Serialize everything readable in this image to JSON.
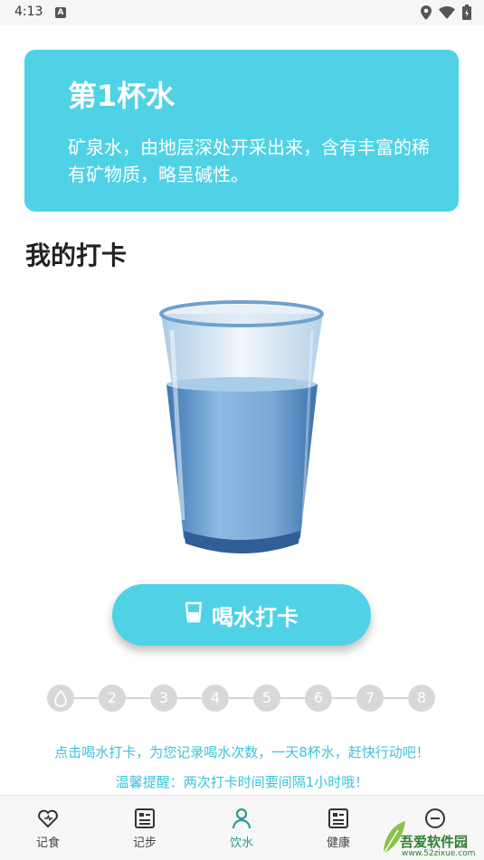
{
  "status_bar": {
    "time": "4:13",
    "notification_icon": "A",
    "icons": [
      "location-icon",
      "wifi-icon",
      "battery-icon"
    ]
  },
  "info_card": {
    "title": "第1杯水",
    "description": "矿泉水，由地层深处开采出来，含有丰富的稀有矿物质，略呈碱性。",
    "background": "#4fd2e6"
  },
  "section_title": "我的打卡",
  "glass": {
    "fill_level": 0.58,
    "water_color": "#7fb0d9"
  },
  "drink_button": {
    "label": "喝水打卡",
    "icon": "cup-icon",
    "color": "#4fd2e6"
  },
  "progress": {
    "steps": [
      "",
      "2",
      "3",
      "4",
      "5",
      "6",
      "7",
      "8"
    ],
    "current_icon": "drop-icon",
    "completed": 0
  },
  "hints": {
    "line1": "点击喝水打卡，为您记录喝水次数，一天8杯水，赶快行动吧！",
    "line2": "温馨提醒：两次打卡时间要间隔1小时哦！"
  },
  "tabs": [
    {
      "label": "记食",
      "icon": "heart-icon"
    },
    {
      "label": "记步",
      "icon": "list-icon"
    },
    {
      "label": "饮水",
      "icon": "person-icon",
      "active": true
    },
    {
      "label": "健康",
      "icon": "report-icon"
    },
    {
      "label": "我的",
      "icon": "profile-icon"
    }
  ],
  "watermark": {
    "title": "吾爱软件园",
    "url": "www.52zixue.com"
  }
}
